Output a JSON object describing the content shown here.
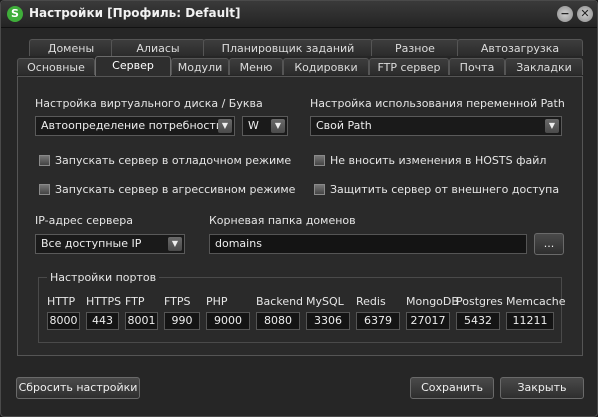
{
  "window": {
    "app_icon_letter": "S",
    "title": "Настройки [Профиль: Default]",
    "minimize_label": "−",
    "close_label": "✕"
  },
  "tabs_back": [
    "Домены",
    "Алиасы",
    "Планировщик заданий",
    "Разное",
    "Автозагрузка"
  ],
  "tabs_front": [
    "Основные",
    "Сервер",
    "Модули",
    "Меню",
    "Кодировки",
    "FTP сервер",
    "Почта",
    "Закладки"
  ],
  "active_tab": "Сервер",
  "server": {
    "vdisk_label": "Настройка виртуального диска / Буква",
    "vdisk_value": "Автоопределение потребности",
    "vdisk_letter": "W",
    "path_label": "Настройка использования переменной Path",
    "path_value": "Свой Path",
    "checkboxes": [
      "Запускать сервер в отладочном режиме",
      "Не вносить изменения в HOSTS файл",
      "Запускать сервер в агрессивном режиме",
      "Защитить сервер от внешнего доступа"
    ],
    "ip_label": "IP-адрес сервера",
    "ip_value": "Все доступные IP",
    "domains_label": "Корневая папка доменов",
    "domains_value": "domains",
    "browse_label": "..."
  },
  "ports": {
    "legend": "Настройки портов",
    "items": [
      {
        "label": "HTTP",
        "value": "8000"
      },
      {
        "label": "HTTPS",
        "value": "443"
      },
      {
        "label": "FTP",
        "value": "8001"
      },
      {
        "label": "FTPS",
        "value": "990"
      },
      {
        "label": "PHP",
        "value": "9000"
      },
      {
        "label": "Backend",
        "value": "8080"
      },
      {
        "label": "MySQL",
        "value": "3306"
      },
      {
        "label": "Redis",
        "value": "6379"
      },
      {
        "label": "MongoDB",
        "value": "27017"
      },
      {
        "label": "Postgres",
        "value": "5432"
      },
      {
        "label": "Memcache",
        "value": "11211"
      }
    ]
  },
  "buttons": {
    "reset": "Сбросить настройки",
    "save": "Сохранить",
    "close": "Закрыть"
  }
}
